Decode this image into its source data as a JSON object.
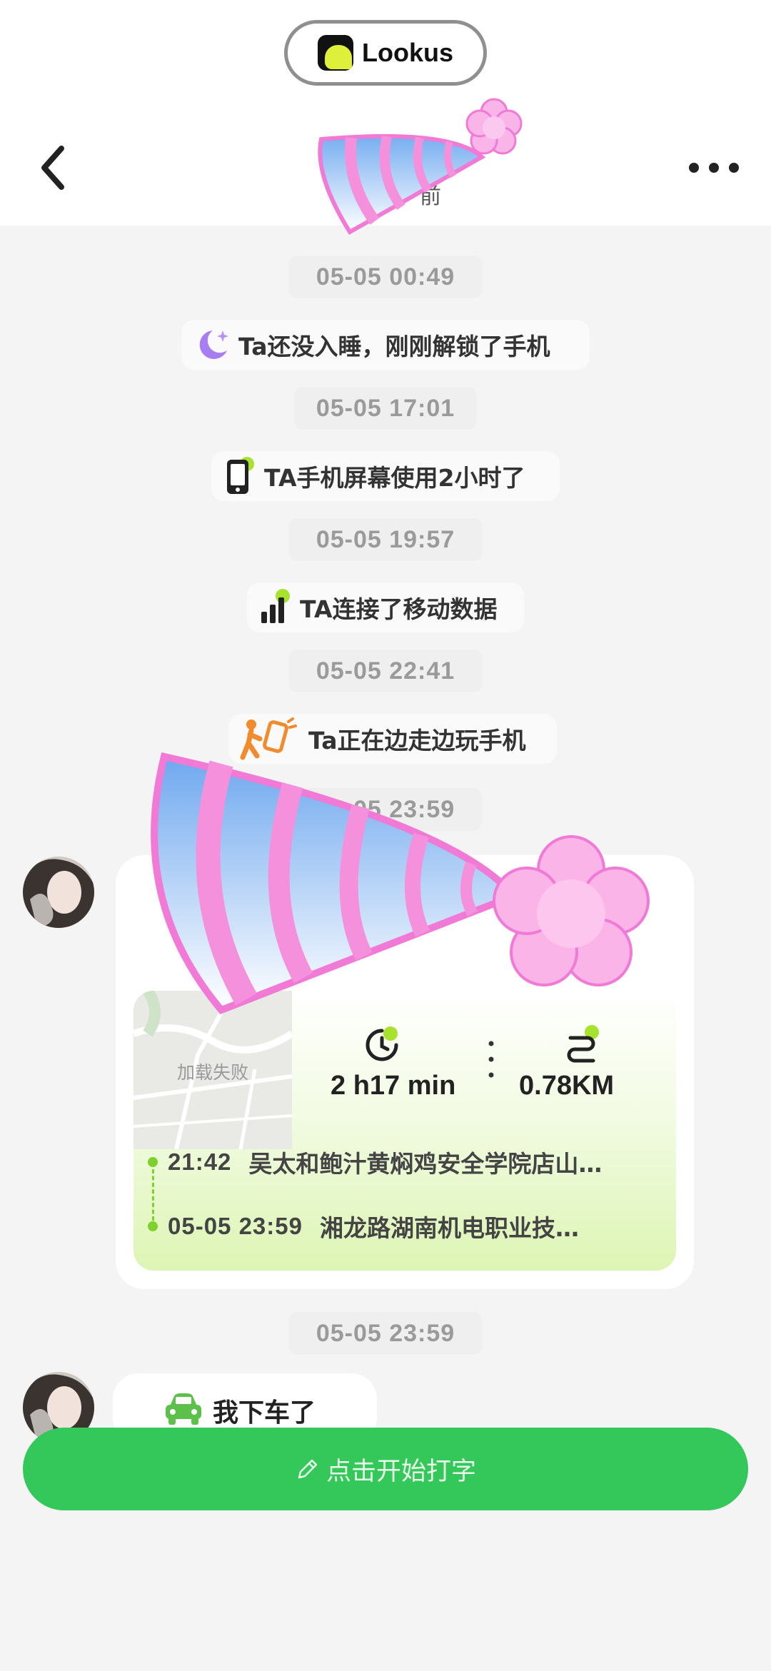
{
  "app": {
    "brand": "Lookus"
  },
  "header": {
    "back_icon": "chevron-left-icon",
    "more_icon": "more-dots-icon",
    "title_partial": "前"
  },
  "timeline": [
    {
      "time": "05-05 00:49",
      "event": "Ta还没入睡，刚刚解锁了手机",
      "icon": "moon-icon"
    },
    {
      "time": "05-05 17:01",
      "event": "TA手机屏幕使用2小时了",
      "icon": "phone-icon"
    },
    {
      "time": "05-05 19:57",
      "event": "TA连接了移动数据",
      "icon": "signal-icon"
    },
    {
      "time": "05-05 22:41",
      "event": "Ta正在边走边玩手机",
      "icon": "walking-phone-icon"
    },
    {
      "time": "05-05 23:59"
    }
  ],
  "trip": {
    "map_failed": "加载失败",
    "duration": "2 h17 min",
    "distance": "0.78KM",
    "start_time": "21:42",
    "start_place": "吴太和鲍汁黄焖鸡安全学院店山…",
    "end_time": "05-05 23:59",
    "end_place": "湘龙路湖南机电职业技…"
  },
  "last": {
    "time": "05-05 23:59",
    "message": "我下车了",
    "icon": "car-icon"
  },
  "input": {
    "placeholder": "点击开始打字",
    "icon": "pencil-icon"
  },
  "colors": {
    "green": "#34c759",
    "accent_lime": "#a6e22e",
    "pink": "#f27ad9",
    "blue": "#7fb2f0"
  }
}
